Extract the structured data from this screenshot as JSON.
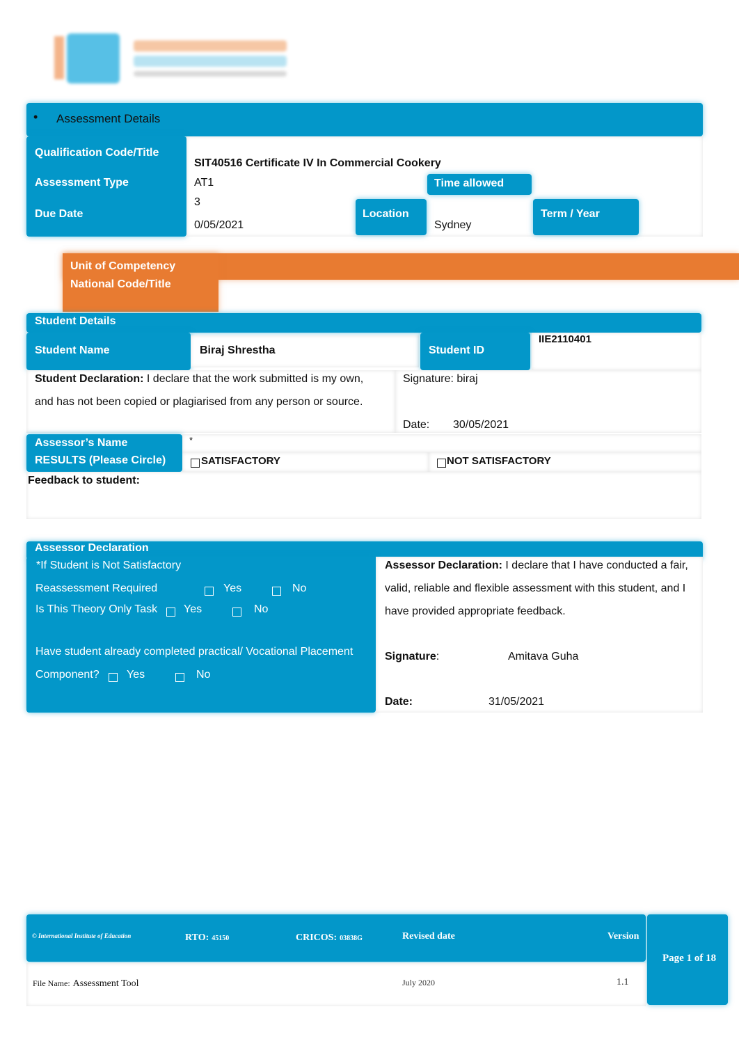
{
  "logo": {
    "name": "international-institute-of-education-logo",
    "colors": {
      "orange": "#f4b48a",
      "blue": "#57c0e6"
    }
  },
  "colors": {
    "primary_blue": "#0397c9",
    "accent_orange": "#e87b31"
  },
  "assessment_details": {
    "header": "Assessment Details",
    "qualification_label": "Qualification Code/Title",
    "qualification_value": "SIT40516 Certificate IV In Commercial Cookery",
    "assessment_type_label": "Assessment Type",
    "assessment_type_value": "AT1",
    "time_allowed_label": "Time allowed",
    "time_allowed_value": "",
    "due_date_label": "Due Date",
    "due_date_value_line1": "3",
    "due_date_value_line2": "0/05/2021",
    "location_label": "Location",
    "location_value": "Sydney",
    "term_year_label": "Term / Year",
    "term_year_value": ""
  },
  "unit_of_competency": {
    "label_line1": "Unit of Competency",
    "label_line2": "National Code/Title",
    "value": ""
  },
  "student_details": {
    "header": "Student Details",
    "name_label": "Student Name",
    "name_value": "Biraj Shrestha",
    "id_label": "Student ID",
    "id_value": "IIE2110401",
    "declaration_label": "Student Declaration:",
    "declaration_text_line1": " I declare that the work submitted is my own,",
    "declaration_text_line2": "and has not been copied or plagiarised from any person or source.",
    "signature_label": "Signature:",
    "signature_value": "biraj",
    "date_label": "Date:",
    "date_value": "30/05/2021"
  },
  "results": {
    "assessor_name_label": "Assessor’s Name",
    "assessor_name_value": "*",
    "results_label": "RESULTS (Please Circle)",
    "satisfactory": "SATISFACTORY",
    "not_satisfactory": "NOT SATISFACTORY",
    "feedback_label": "Feedback to student:",
    "feedback_value": ""
  },
  "assessor_declaration": {
    "header": "Assessor Declaration",
    "not_satisfactory_note": "*If Student is Not Satisfactory",
    "reassessment_label": "Reassessment Required",
    "theory_only_label": "Is This Theory Only Task",
    "practical_label_line1": "Have student already completed practical/ Vocational Placement",
    "practical_label_line2": "Component?",
    "yes": "Yes",
    "no": "No",
    "declaration_label": "Assessor Declaration:",
    "declaration_line1": " I declare that I have conducted a fair,",
    "declaration_line2": "valid, reliable and flexible assessment with this student, and I",
    "declaration_line3": "have provided appropriate feedback.",
    "signature_label": "Signature",
    "signature_colon": ":",
    "signature_value": "Amitava Guha",
    "date_label": "Date:",
    "date_value": "31/05/2021"
  },
  "footer": {
    "copyright": "© International Institute of Education",
    "rto_label": "RTO:",
    "rto_value": "45150",
    "cricos_label": "CRICOS:",
    "cricos_value": "03838G",
    "revised_date_label": "Revised date",
    "revised_date_value": "July 2020",
    "version_label": "Version",
    "version_value": "1.1",
    "file_name_label": "File Name:",
    "file_name_value": "Assessment Tool",
    "page_indicator": "Page 1 of 18"
  }
}
